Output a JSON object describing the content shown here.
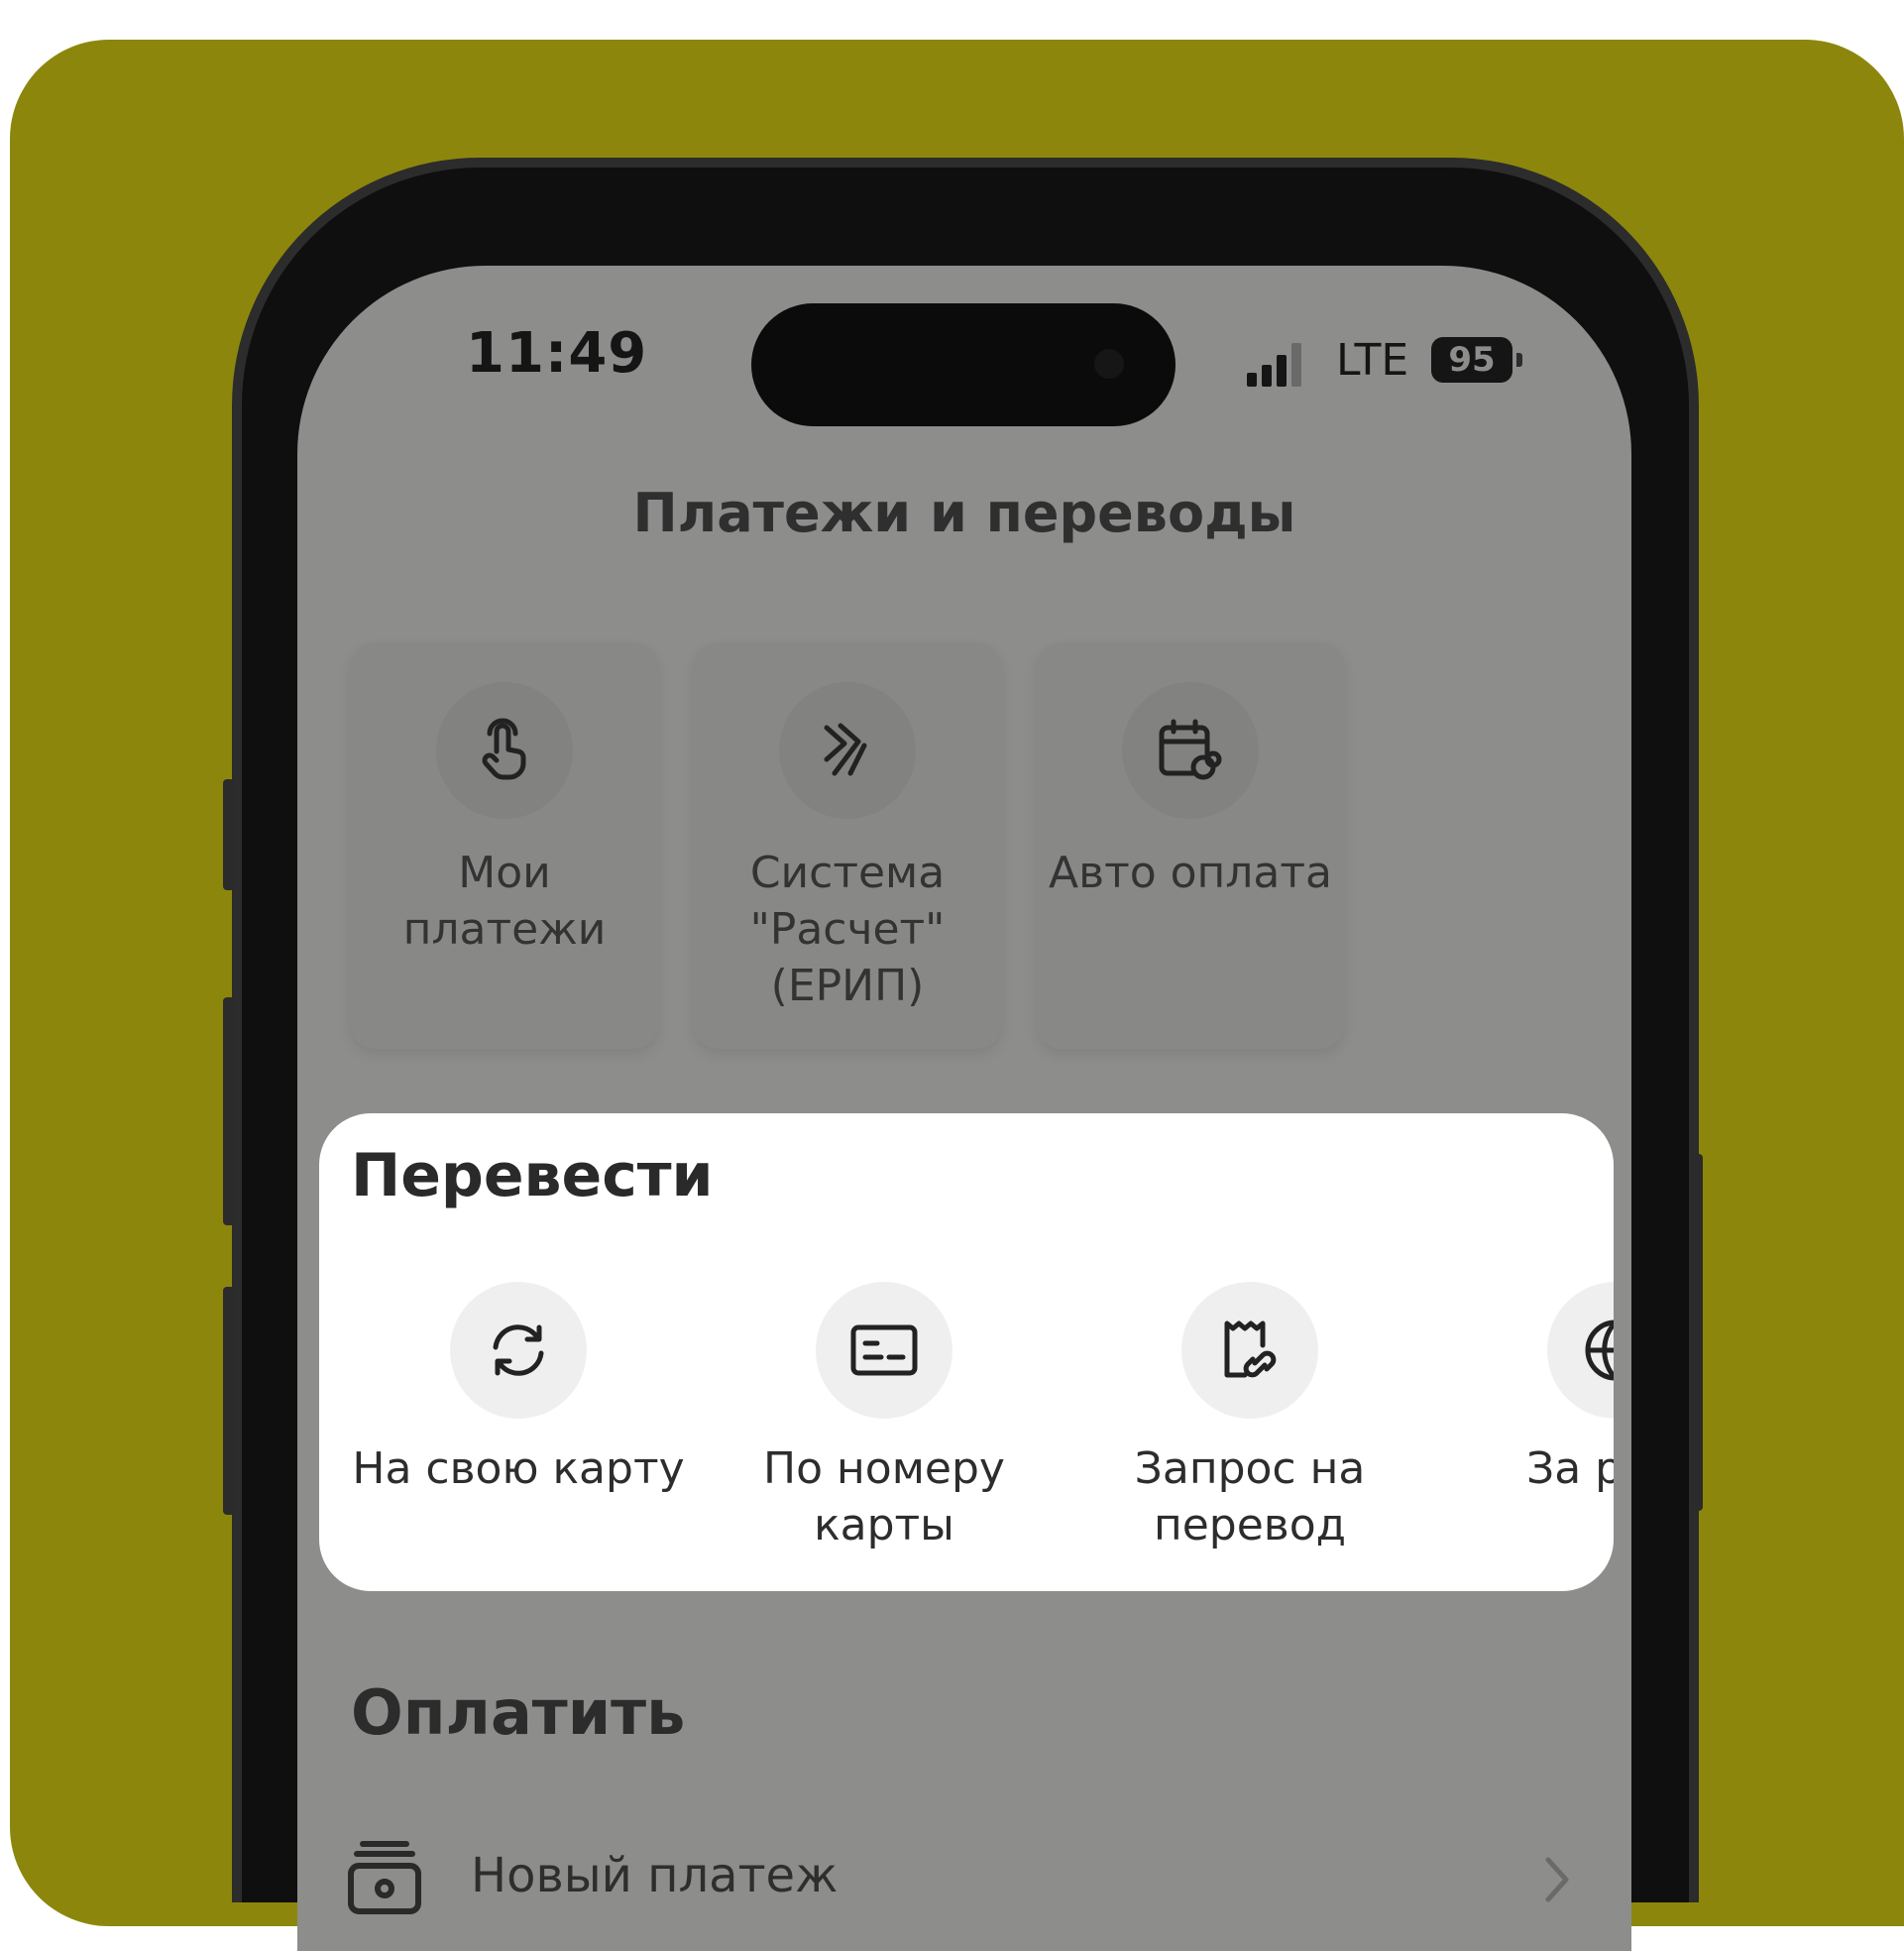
{
  "status_bar": {
    "time": "11:49",
    "network": "LTE",
    "battery": "95"
  },
  "header": {
    "title": "Платежи и переводы"
  },
  "quick_tiles": [
    {
      "label": "Мои платежи",
      "icon": "tap-finger-icon"
    },
    {
      "label": "Система \"Расчет\" (ЕРИП)",
      "icon": "double-chevron-icon"
    },
    {
      "label": "Авто оплата",
      "icon": "calendar-coin-icon"
    }
  ],
  "transfer": {
    "title": "Перевести",
    "items": [
      {
        "label": "На свою карту",
        "icon": "refresh-arrows-icon"
      },
      {
        "label": "По номеру карты",
        "icon": "card-icon"
      },
      {
        "label": "Запрос на перевод",
        "icon": "receipt-link-icon"
      },
      {
        "label": "За ру",
        "icon": "globe-icon"
      }
    ]
  },
  "pay": {
    "title": "Оплатить",
    "items": [
      {
        "label": "Новый платеж",
        "icon": "cash-stack-icon"
      }
    ]
  },
  "colors": {
    "backdrop": "#8c870c",
    "screen_dimmed": "#8d8d8c",
    "card": "#ffffff"
  }
}
